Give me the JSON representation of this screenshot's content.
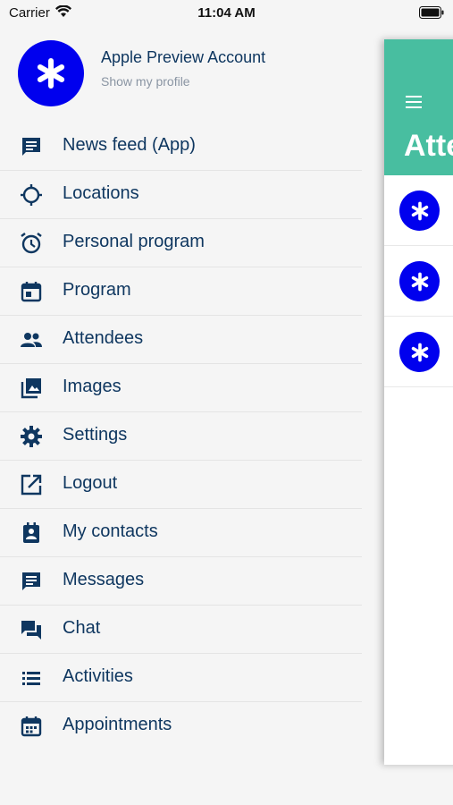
{
  "status_bar": {
    "carrier": "Carrier",
    "time": "11:04 AM"
  },
  "profile": {
    "name": "Apple Preview Account",
    "subtitle": "Show my profile",
    "avatar_color": "#0000ee"
  },
  "menu": {
    "items": [
      {
        "label": "News feed (App)",
        "icon": "news-feed-icon"
      },
      {
        "label": "Locations",
        "icon": "locations-icon"
      },
      {
        "label": "Personal program",
        "icon": "alarm-clock-icon"
      },
      {
        "label": "Program",
        "icon": "calendar-icon"
      },
      {
        "label": "Attendees",
        "icon": "people-icon"
      },
      {
        "label": "Images",
        "icon": "images-icon"
      },
      {
        "label": "Settings",
        "icon": "gear-icon"
      },
      {
        "label": "Logout",
        "icon": "logout-icon"
      },
      {
        "label": "My contacts",
        "icon": "contacts-icon"
      },
      {
        "label": "Messages",
        "icon": "messages-icon"
      },
      {
        "label": "Chat",
        "icon": "chat-icon"
      },
      {
        "label": "Activities",
        "icon": "list-icon"
      },
      {
        "label": "Appointments",
        "icon": "appointments-icon"
      }
    ]
  },
  "panel": {
    "title": "Atte",
    "header_color": "#48bea0",
    "rows": 3
  },
  "colors": {
    "accent": "#48bea0",
    "text": "#0f3760",
    "avatar": "#0000ee"
  }
}
